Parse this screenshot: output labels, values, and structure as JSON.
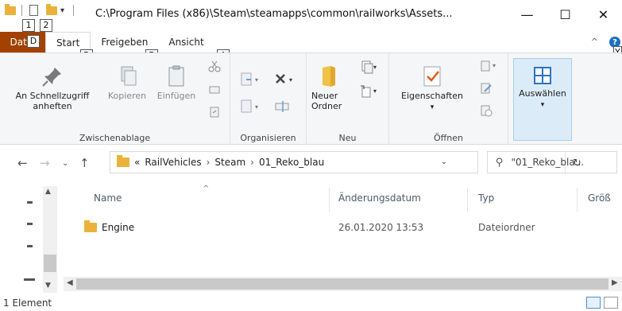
{
  "titlebar": {
    "path": "C:\\Program Files (x86)\\Steam\\steamapps\\common\\railworks\\Assets...",
    "minimize": "—",
    "maximize": "☐",
    "close": "✕"
  },
  "keytips": {
    "qat1": "1",
    "qat2": "2",
    "file": "D",
    "start": "R",
    "share": "B",
    "view": "A",
    "help": "Y"
  },
  "tabs": {
    "file": "Datei",
    "start": "Start",
    "share": "Freigeben",
    "view": "Ansicht"
  },
  "ribbon": {
    "clipboard": {
      "label": "Zwischenablage",
      "pin": "An Schnellzugriff\nanheften",
      "pin_line1": "An Schnellzugriff",
      "pin_line2": "anheften",
      "copy": "Kopieren",
      "paste": "Einfügen"
    },
    "organize": {
      "label": "Organisieren"
    },
    "new": {
      "label": "Neu",
      "new_folder_line1": "Neuer",
      "new_folder_line2": "Ordner"
    },
    "open": {
      "label": "Öffnen",
      "properties": "Eigenschaften"
    },
    "select": {
      "label": "Auswählen"
    }
  },
  "address": {
    "overflow": "«",
    "crumbs": [
      "RailVehicles",
      "Steam",
      "01_Reko_blau"
    ]
  },
  "search": {
    "placeholder": "\"01_Reko_bla..."
  },
  "columns": {
    "name": "Name",
    "modified": "Änderungsdatum",
    "type": "Typ",
    "size": "Größ"
  },
  "rows": [
    {
      "name": "Engine",
      "modified": "26.01.2020 13:53",
      "type": "Dateiordner"
    }
  ],
  "status": {
    "count": "1 Element"
  },
  "colors": {
    "file_tab": "#a34200",
    "folder": "#e9b23a",
    "accent": "#1a6fc2"
  }
}
